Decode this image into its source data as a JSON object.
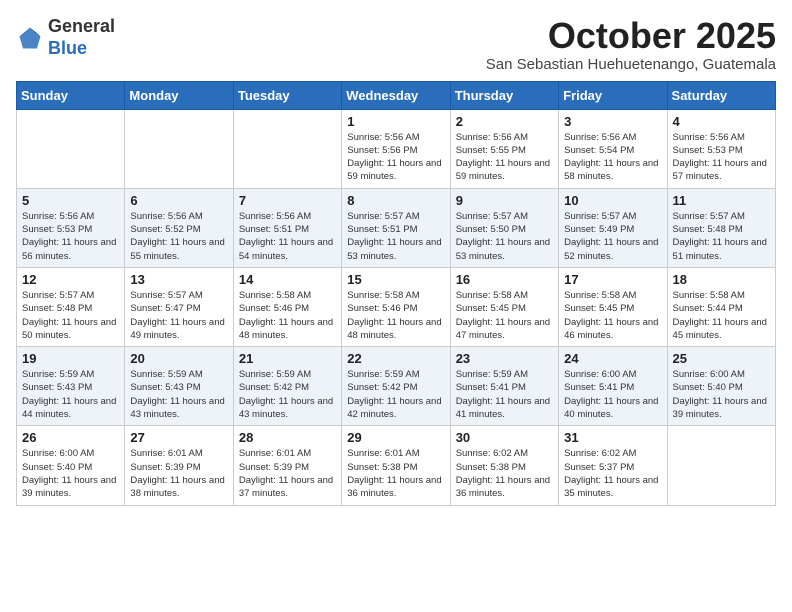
{
  "header": {
    "logo_general": "General",
    "logo_blue": "Blue",
    "month": "October 2025",
    "location": "San Sebastian Huehuetenango, Guatemala"
  },
  "days_of_week": [
    "Sunday",
    "Monday",
    "Tuesday",
    "Wednesday",
    "Thursday",
    "Friday",
    "Saturday"
  ],
  "weeks": [
    [
      {
        "day": "",
        "info": ""
      },
      {
        "day": "",
        "info": ""
      },
      {
        "day": "",
        "info": ""
      },
      {
        "day": "1",
        "info": "Sunrise: 5:56 AM\nSunset: 5:56 PM\nDaylight: 11 hours\nand 59 minutes."
      },
      {
        "day": "2",
        "info": "Sunrise: 5:56 AM\nSunset: 5:55 PM\nDaylight: 11 hours\nand 59 minutes."
      },
      {
        "day": "3",
        "info": "Sunrise: 5:56 AM\nSunset: 5:54 PM\nDaylight: 11 hours\nand 58 minutes."
      },
      {
        "day": "4",
        "info": "Sunrise: 5:56 AM\nSunset: 5:53 PM\nDaylight: 11 hours\nand 57 minutes."
      }
    ],
    [
      {
        "day": "5",
        "info": "Sunrise: 5:56 AM\nSunset: 5:53 PM\nDaylight: 11 hours\nand 56 minutes."
      },
      {
        "day": "6",
        "info": "Sunrise: 5:56 AM\nSunset: 5:52 PM\nDaylight: 11 hours\nand 55 minutes."
      },
      {
        "day": "7",
        "info": "Sunrise: 5:56 AM\nSunset: 5:51 PM\nDaylight: 11 hours\nand 54 minutes."
      },
      {
        "day": "8",
        "info": "Sunrise: 5:57 AM\nSunset: 5:51 PM\nDaylight: 11 hours\nand 53 minutes."
      },
      {
        "day": "9",
        "info": "Sunrise: 5:57 AM\nSunset: 5:50 PM\nDaylight: 11 hours\nand 53 minutes."
      },
      {
        "day": "10",
        "info": "Sunrise: 5:57 AM\nSunset: 5:49 PM\nDaylight: 11 hours\nand 52 minutes."
      },
      {
        "day": "11",
        "info": "Sunrise: 5:57 AM\nSunset: 5:48 PM\nDaylight: 11 hours\nand 51 minutes."
      }
    ],
    [
      {
        "day": "12",
        "info": "Sunrise: 5:57 AM\nSunset: 5:48 PM\nDaylight: 11 hours\nand 50 minutes."
      },
      {
        "day": "13",
        "info": "Sunrise: 5:57 AM\nSunset: 5:47 PM\nDaylight: 11 hours\nand 49 minutes."
      },
      {
        "day": "14",
        "info": "Sunrise: 5:58 AM\nSunset: 5:46 PM\nDaylight: 11 hours\nand 48 minutes."
      },
      {
        "day": "15",
        "info": "Sunrise: 5:58 AM\nSunset: 5:46 PM\nDaylight: 11 hours\nand 48 minutes."
      },
      {
        "day": "16",
        "info": "Sunrise: 5:58 AM\nSunset: 5:45 PM\nDaylight: 11 hours\nand 47 minutes."
      },
      {
        "day": "17",
        "info": "Sunrise: 5:58 AM\nSunset: 5:45 PM\nDaylight: 11 hours\nand 46 minutes."
      },
      {
        "day": "18",
        "info": "Sunrise: 5:58 AM\nSunset: 5:44 PM\nDaylight: 11 hours\nand 45 minutes."
      }
    ],
    [
      {
        "day": "19",
        "info": "Sunrise: 5:59 AM\nSunset: 5:43 PM\nDaylight: 11 hours\nand 44 minutes."
      },
      {
        "day": "20",
        "info": "Sunrise: 5:59 AM\nSunset: 5:43 PM\nDaylight: 11 hours\nand 43 minutes."
      },
      {
        "day": "21",
        "info": "Sunrise: 5:59 AM\nSunset: 5:42 PM\nDaylight: 11 hours\nand 43 minutes."
      },
      {
        "day": "22",
        "info": "Sunrise: 5:59 AM\nSunset: 5:42 PM\nDaylight: 11 hours\nand 42 minutes."
      },
      {
        "day": "23",
        "info": "Sunrise: 5:59 AM\nSunset: 5:41 PM\nDaylight: 11 hours\nand 41 minutes."
      },
      {
        "day": "24",
        "info": "Sunrise: 6:00 AM\nSunset: 5:41 PM\nDaylight: 11 hours\nand 40 minutes."
      },
      {
        "day": "25",
        "info": "Sunrise: 6:00 AM\nSunset: 5:40 PM\nDaylight: 11 hours\nand 39 minutes."
      }
    ],
    [
      {
        "day": "26",
        "info": "Sunrise: 6:00 AM\nSunset: 5:40 PM\nDaylight: 11 hours\nand 39 minutes."
      },
      {
        "day": "27",
        "info": "Sunrise: 6:01 AM\nSunset: 5:39 PM\nDaylight: 11 hours\nand 38 minutes."
      },
      {
        "day": "28",
        "info": "Sunrise: 6:01 AM\nSunset: 5:39 PM\nDaylight: 11 hours\nand 37 minutes."
      },
      {
        "day": "29",
        "info": "Sunrise: 6:01 AM\nSunset: 5:38 PM\nDaylight: 11 hours\nand 36 minutes."
      },
      {
        "day": "30",
        "info": "Sunrise: 6:02 AM\nSunset: 5:38 PM\nDaylight: 11 hours\nand 36 minutes."
      },
      {
        "day": "31",
        "info": "Sunrise: 6:02 AM\nSunset: 5:37 PM\nDaylight: 11 hours\nand 35 minutes."
      },
      {
        "day": "",
        "info": ""
      }
    ]
  ]
}
